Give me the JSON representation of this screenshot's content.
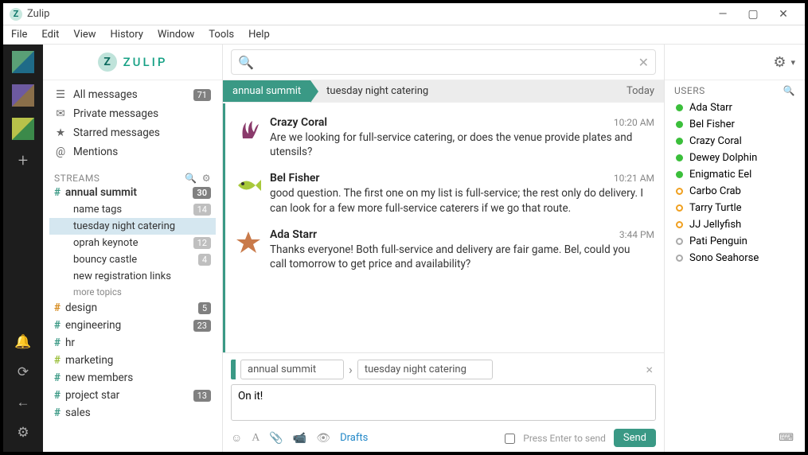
{
  "window": {
    "title": "Zulip",
    "min": "—",
    "max": "▢",
    "close": "✕"
  },
  "menu": [
    "File",
    "Edit",
    "View",
    "History",
    "Window",
    "Tools",
    "Help"
  ],
  "brand": {
    "glyph": "Z",
    "word": "ZULIP"
  },
  "nav": {
    "all": {
      "label": "All messages",
      "badge": "71"
    },
    "pm": {
      "label": "Private messages"
    },
    "star": {
      "label": "Starred messages"
    },
    "ment": {
      "label": "Mentions"
    }
  },
  "streams_header": "STREAMS",
  "streams": [
    {
      "name": "annual summit",
      "color": "#3a9985",
      "badge": "30",
      "active": true,
      "topics": [
        {
          "name": "name tags",
          "badge": "14"
        },
        {
          "name": "tuesday night catering",
          "active": true
        },
        {
          "name": "oprah keynote",
          "badge": "12"
        },
        {
          "name": "bouncy castle",
          "badge": "4"
        },
        {
          "name": "new registration links"
        }
      ],
      "more": "more topics"
    },
    {
      "name": "design",
      "color": "#d68b1f",
      "badge": "5"
    },
    {
      "name": "engineering",
      "color": "#3a9985",
      "badge": "23"
    },
    {
      "name": "hr",
      "color": "#3a9985"
    },
    {
      "name": "marketing",
      "color": "#9bbf3b"
    },
    {
      "name": "new members",
      "color": "#3a9985"
    },
    {
      "name": "project star",
      "color": "#3a9985",
      "badge": "13"
    },
    {
      "name": "sales",
      "color": "#3a9985"
    }
  ],
  "crumb": {
    "stream": "annual summit",
    "topic": "tuesday night catering",
    "date": "Today"
  },
  "messages": [
    {
      "avatar": "coral",
      "name": "Crazy Coral",
      "time": "10:20 AM",
      "body": "Are we looking for full-service catering, or does the venue provide plates and utensils?"
    },
    {
      "avatar": "fish",
      "name": "Bel Fisher",
      "time": "10:21 AM",
      "body": "good question. The first one on my list is full-service; the rest only do delivery. I can look for a few more full-service caterers if we go that route."
    },
    {
      "avatar": "star",
      "name": "Ada Starr",
      "time": "3:44 PM",
      "body": "Thanks everyone! Both full-service and delivery are fair game. Bel, could you call tomorrow to get price and availability?"
    }
  ],
  "compose": {
    "stream": "annual summit",
    "topic": "tuesday night catering",
    "draft": "On it!",
    "drafts_label": "Drafts",
    "hint": "Press Enter to send",
    "send": "Send"
  },
  "users_header": "USERS",
  "users": [
    {
      "name": "Ada Starr",
      "p": "active"
    },
    {
      "name": "Bel Fisher",
      "p": "active"
    },
    {
      "name": "Crazy Coral",
      "p": "active"
    },
    {
      "name": "Dewey Dolphin",
      "p": "active"
    },
    {
      "name": "Enigmatic Eel",
      "p": "active"
    },
    {
      "name": "Carbo Crab",
      "p": "idle"
    },
    {
      "name": "Tarry Turtle",
      "p": "idle"
    },
    {
      "name": "JJ Jellyfish",
      "p": "idle"
    },
    {
      "name": "Pati Penguin",
      "p": "off"
    },
    {
      "name": "Sono Seahorse",
      "p": "off"
    }
  ],
  "search": {
    "placeholder": ""
  }
}
